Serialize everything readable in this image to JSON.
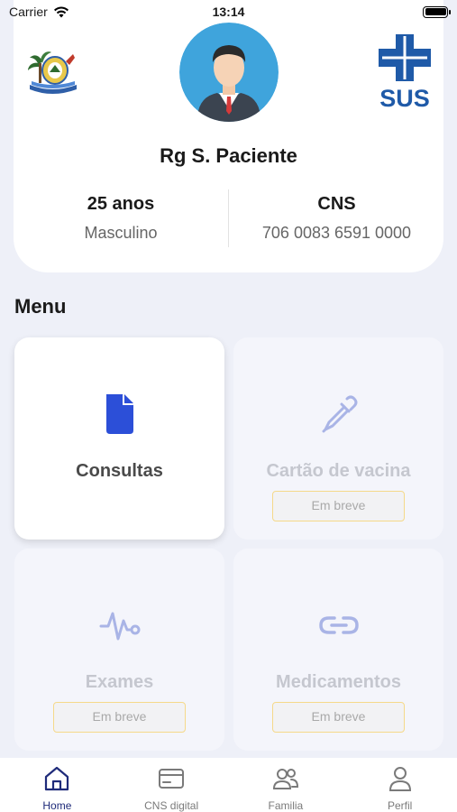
{
  "status_bar": {
    "carrier": "Carrier",
    "time": "13:14"
  },
  "profile": {
    "name": "Rg S. Paciente",
    "age": "25 anos",
    "gender": "Masculino",
    "cns_label": "CNS",
    "cns_number": "706 0083 6591 0000",
    "sus_logo_text": "SUS"
  },
  "menu": {
    "title": "Menu",
    "items": [
      {
        "label": "Consultas",
        "icon": "document-icon",
        "status": ""
      },
      {
        "label": "Cartão de vacina",
        "icon": "dropper-icon",
        "status": "Em breve"
      },
      {
        "label": "Exames",
        "icon": "pulse-icon",
        "status": "Em breve"
      },
      {
        "label": "Medicamentos",
        "icon": "link-icon",
        "status": "Em breve"
      }
    ]
  },
  "tabs": [
    {
      "label": "Home",
      "icon": "home-icon",
      "active": true
    },
    {
      "label": "CNS digital",
      "icon": "card-icon",
      "active": false
    },
    {
      "label": "Familia",
      "icon": "people-icon",
      "active": false
    },
    {
      "label": "Perfil",
      "icon": "person-icon",
      "active": false
    }
  ],
  "colors": {
    "accent": "#1f2b7a",
    "sus_blue": "#1f5aa8",
    "consultas_icon": "#2c4fd8",
    "disabled_icon": "#a9b4e6",
    "background": "#eef0f8",
    "badge_border": "#f5d98a"
  }
}
